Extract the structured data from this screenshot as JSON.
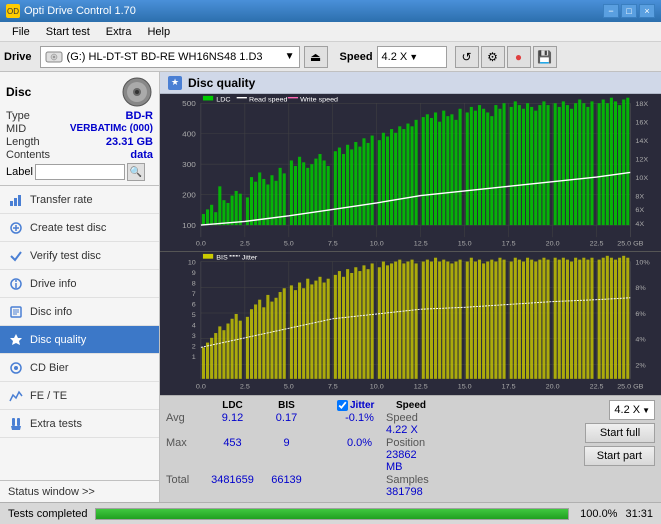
{
  "app": {
    "title": "Opti Drive Control 1.70",
    "icon": "OD"
  },
  "titlebar": {
    "minimize": "−",
    "maximize": "□",
    "close": "×"
  },
  "menubar": {
    "items": [
      "File",
      "Start test",
      "Extra",
      "Help"
    ]
  },
  "drivebar": {
    "label": "Drive",
    "drive_name": "(G:)  HL-DT-ST BD-RE  WH16NS48 1.D3",
    "speed_label": "Speed",
    "speed_value": "4.2 X",
    "dropdown_arrow": "▼"
  },
  "disc_panel": {
    "label": "Disc",
    "type_label": "Type",
    "type_value": "BD-R",
    "mid_label": "MID",
    "mid_value": "VERBATIMc (000)",
    "length_label": "Length",
    "length_value": "23.31 GB",
    "contents_label": "Contents",
    "contents_value": "data",
    "label_label": "Label",
    "label_placeholder": ""
  },
  "nav": {
    "items": [
      {
        "id": "transfer-rate",
        "label": "Transfer rate",
        "icon": "📊"
      },
      {
        "id": "create-test-disc",
        "label": "Create test disc",
        "icon": "💿"
      },
      {
        "id": "verify-test-disc",
        "label": "Verify test disc",
        "icon": "✓"
      },
      {
        "id": "drive-info",
        "label": "Drive info",
        "icon": "ℹ"
      },
      {
        "id": "disc-info",
        "label": "Disc info",
        "icon": "📋"
      },
      {
        "id": "disc-quality",
        "label": "Disc quality",
        "icon": "★",
        "active": true
      },
      {
        "id": "cd-bier",
        "label": "CD Bier",
        "icon": "🍺"
      },
      {
        "id": "fe-te",
        "label": "FE / TE",
        "icon": "📈"
      },
      {
        "id": "extra-tests",
        "label": "Extra tests",
        "icon": "🔬"
      }
    ],
    "status_window": "Status window >>"
  },
  "disc_quality": {
    "title": "Disc quality",
    "chart1": {
      "title": "LDC",
      "legend": [
        {
          "label": "LDC",
          "color": "#00aa00"
        },
        {
          "label": "Read speed",
          "color": "#ffffff"
        },
        {
          "label": "Write speed",
          "color": "#ff69b4"
        }
      ],
      "y_max": 500,
      "y_labels": [
        "500",
        "400",
        "300",
        "200",
        "100"
      ],
      "right_labels": [
        "18X",
        "16X",
        "14X",
        "12X",
        "10X",
        "8X",
        "6X",
        "4X"
      ],
      "x_labels": [
        "0.0",
        "2.5",
        "5.0",
        "7.5",
        "10.0",
        "12.5",
        "15.0",
        "17.5",
        "20.0",
        "22.5",
        "25.0 GB"
      ]
    },
    "chart2": {
      "title": "BIS",
      "legend": [
        {
          "label": "BIS",
          "color": "#ffff00"
        },
        {
          "label": "Jitter",
          "color": "#ffffff"
        }
      ],
      "y_max": 10,
      "y_labels": [
        "10",
        "9",
        "8",
        "7",
        "6",
        "5",
        "4",
        "3",
        "2",
        "1"
      ],
      "right_labels": [
        "10%",
        "8%",
        "6%",
        "4%",
        "2%"
      ],
      "x_labels": [
        "0.0",
        "2.5",
        "5.0",
        "7.5",
        "10.0",
        "12.5",
        "15.0",
        "17.5",
        "20.0",
        "22.5",
        "25.0 GB"
      ]
    }
  },
  "stats": {
    "headers": [
      "",
      "LDC",
      "BIS",
      "",
      "Jitter",
      "Speed",
      ""
    ],
    "avg_label": "Avg",
    "avg_ldc": "9.12",
    "avg_bis": "0.17",
    "avg_jitter": "-0.1%",
    "max_label": "Max",
    "max_ldc": "453",
    "max_bis": "9",
    "max_jitter": "0.0%",
    "total_label": "Total",
    "total_ldc": "3481659",
    "total_bis": "66139",
    "jitter_label": "Jitter",
    "speed_label": "Speed",
    "speed_value": "4.22 X",
    "position_label": "Position",
    "position_value": "23862 MB",
    "samples_label": "Samples",
    "samples_value": "381798",
    "speed_select": "4.2 X",
    "start_full": "Start full",
    "start_part": "Start part"
  },
  "statusbar": {
    "text": "Tests completed",
    "progress": 100,
    "percent": "100.0%",
    "time": "31:31"
  }
}
